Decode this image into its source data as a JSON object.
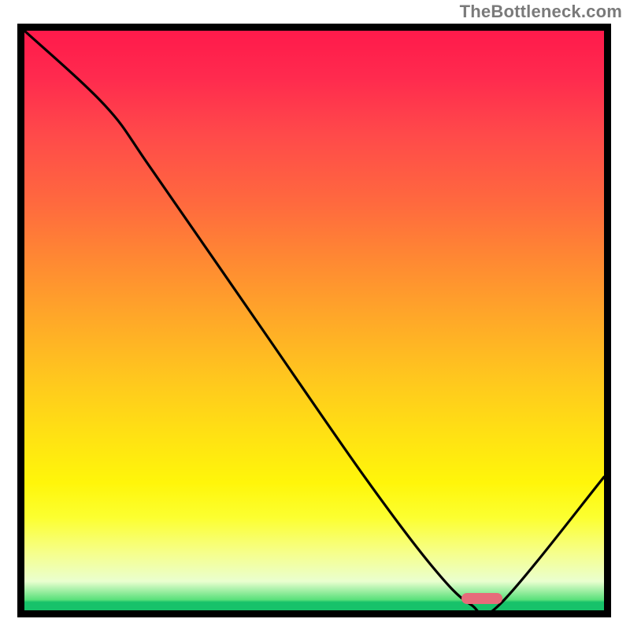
{
  "watermark": "TheBottleneck.com",
  "chart_data": {
    "type": "line",
    "title": "",
    "xlabel": "",
    "ylabel": "",
    "xlim": [
      0,
      100
    ],
    "ylim": [
      0,
      100
    ],
    "grid": false,
    "legend": false,
    "gradient_stops": [
      {
        "pct": 0,
        "color": "#ff1a4b"
      },
      {
        "pct": 18,
        "color": "#ff4a4a"
      },
      {
        "pct": 40,
        "color": "#ff8a32"
      },
      {
        "pct": 60,
        "color": "#ffc71e"
      },
      {
        "pct": 78,
        "color": "#fff60a"
      },
      {
        "pct": 90,
        "color": "#f6ff8a"
      },
      {
        "pct": 97,
        "color": "#eaffcf"
      },
      {
        "pct": 98.4,
        "color": "#17c26a"
      },
      {
        "pct": 100,
        "color": "#17c26a"
      }
    ],
    "series": [
      {
        "name": "bottleneck-curve",
        "x": [
          0,
          14,
          22,
          40,
          58,
          70,
          77,
          82,
          100
        ],
        "y": [
          100,
          87,
          76,
          50,
          24,
          8,
          1,
          1,
          23
        ]
      }
    ],
    "target_marker": {
      "x": 79,
      "y": 2,
      "shape": "pill",
      "color": "#e66b7a"
    },
    "annotations": []
  }
}
